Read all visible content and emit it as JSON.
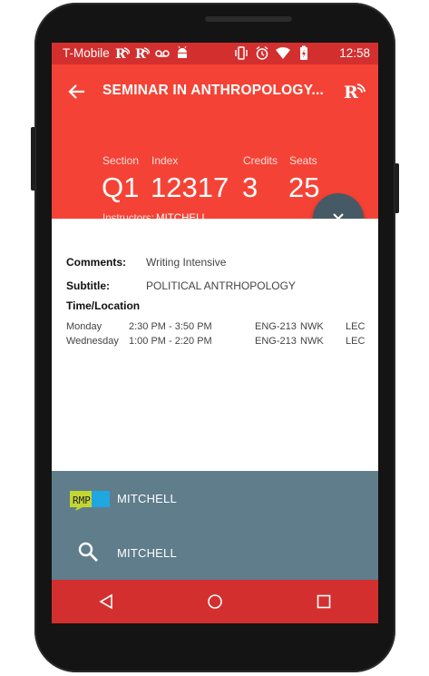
{
  "status_bar": {
    "carrier": "T-Mobile",
    "time": "12:58",
    "icons_left": [
      "rutgers-icon",
      "rutgers-icon",
      "voicemail-icon",
      "android-icon"
    ],
    "icons_right": [
      "vibrate-icon",
      "alarm-icon",
      "wifi-icon",
      "battery-icon"
    ]
  },
  "header": {
    "title": "SEMINAR IN ANTHROPOLOGY...",
    "stats": {
      "section_label": "Section",
      "section_value": "Q1",
      "index_label": "Index",
      "index_value": "12317",
      "credits_label": "Credits",
      "credits_value": "3",
      "seats_label": "Seats",
      "seats_value": "25"
    },
    "instructors_label": "Instructors:",
    "instructors_value": "MITCHELL"
  },
  "details": {
    "comments_label": "Comments:",
    "comments_value": "Writing Intensive",
    "subtitle_label": "Subtitle:",
    "subtitle_value": "POLITICAL ANTRHOPOLOGY",
    "time_location_label": "Time/Location",
    "schedule": [
      {
        "day": "Monday",
        "time": "2:30 PM - 3:50 PM",
        "room": "ENG-213",
        "campus": "NWK",
        "type": "LEC"
      },
      {
        "day": "Wednesday",
        "time": "1:00 PM - 2:20 PM",
        "room": "ENG-213",
        "campus": "NWK",
        "type": "LEC"
      }
    ]
  },
  "bottom_panel": {
    "rmp_logo_text": "RMP",
    "rmp_label": "MITCHELL",
    "search_label": "MITCHELL"
  },
  "colors": {
    "accent": "#f44336",
    "dark_accent": "#d32f2f",
    "panel": "#607d8b",
    "fab": "#455a64"
  }
}
